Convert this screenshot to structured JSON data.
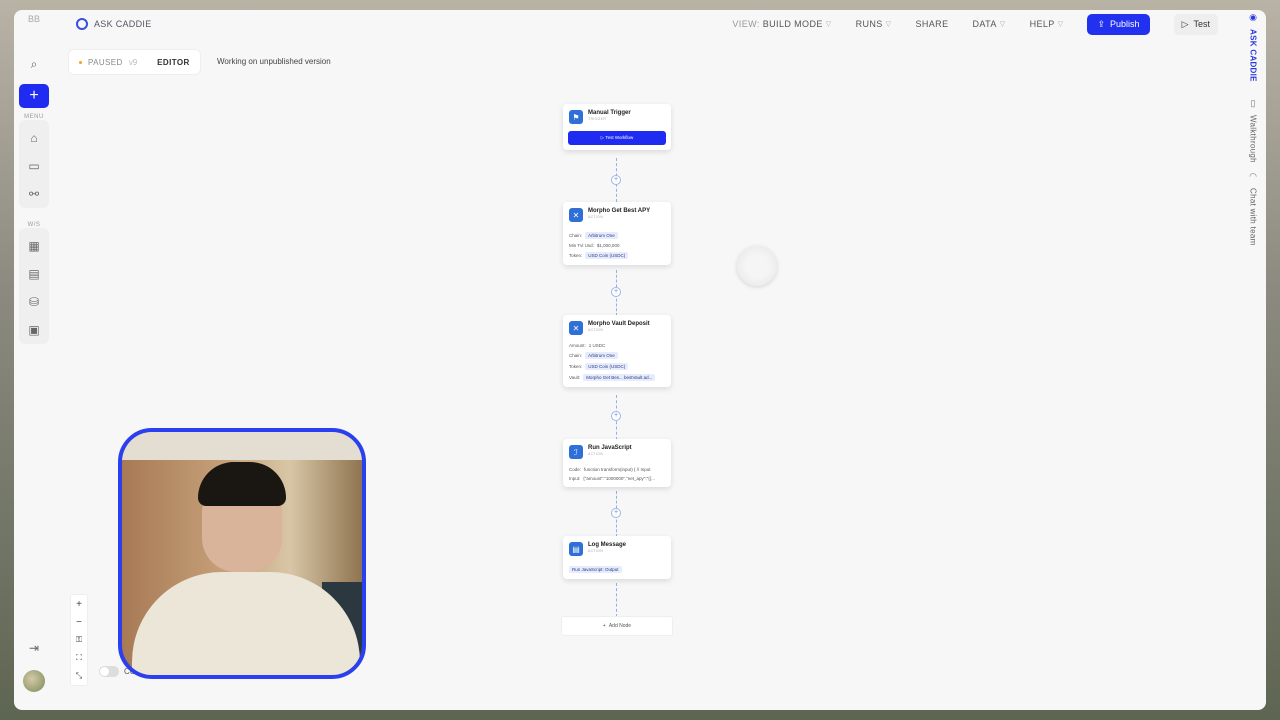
{
  "brand": {
    "name": "ASK CADDIE"
  },
  "sidebar": {
    "logo": "BB",
    "menu_label": "MENU",
    "ws_label": "W/S"
  },
  "topbar": {
    "view_label": "VIEW:",
    "view_value": "BUILD MODE",
    "runs": "RUNS",
    "share": "SHARE",
    "data": "DATA",
    "help": "HELP",
    "publish": "Publish",
    "test": "Test"
  },
  "status": {
    "state": "PAUSED",
    "version": "v9",
    "tab": "EDITOR",
    "message": "Working on unpublished version"
  },
  "rail": {
    "ask": "ASK CADDIE",
    "walkthrough": "Walkthrough",
    "chat": "Chat with team"
  },
  "nodes": {
    "trigger": {
      "title": "Manual Trigger",
      "type": "TRIGGER",
      "button": "Test Workflow"
    },
    "apy": {
      "title": "Morpho Get Best APY",
      "type": "ACTION",
      "chain_label": "Chain:",
      "chain_value": "Arbitrum One",
      "tvl_label": "Min Tvl Usd:",
      "tvl_value": "$1,000,000",
      "token_label": "Token:",
      "token_value": "USD Coin (USDC)"
    },
    "deposit": {
      "title": "Morpho Vault Deposit",
      "type": "ACTION",
      "amount_label": "Amount:",
      "amount_value": "1 USDC",
      "chain_label": "Chain:",
      "chain_value": "Arbitrum One",
      "token_label": "Token:",
      "token_value": "USD Coin (USDC)",
      "vault_label": "Vault:",
      "vault_value": "Morpho Get Bes... bestVault.ad..."
    },
    "js": {
      "title": "Run JavaScript",
      "type": "ACTION",
      "code_label": "Code:",
      "code_value": "function transform(input) { // Input",
      "input_label": "Input:",
      "input_value": "{\"amount\":\"1000000\",\"net_apy\":\"{{..."
    },
    "log": {
      "title": "Log Message",
      "type": "ACTION",
      "chip": "Run JavaScript: Output"
    },
    "add": "Add Node"
  },
  "canvas": {
    "compact_label": "COMP"
  }
}
